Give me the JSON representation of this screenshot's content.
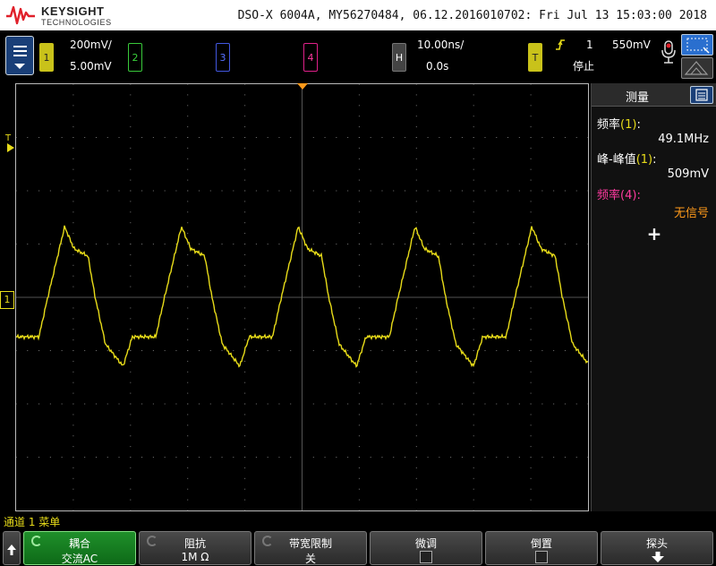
{
  "title_bar": {
    "brand": "KEYSIGHT",
    "brand_sub": "TECHNOLOGIES",
    "device_info": "DSO-X 6004A, MY56270484, 06.12.2016010702: Fri Jul 13 15:03:00 2018"
  },
  "channels": {
    "ch1": {
      "label": "1",
      "scale": "200mV/",
      "offset": "5.00mV",
      "color": "#e8dc19"
    },
    "ch2": {
      "label": "2",
      "color": "#3bd43c"
    },
    "ch3": {
      "label": "3",
      "color": "#5670ff"
    },
    "ch4": {
      "label": "4",
      "color": "#ff3aa0"
    }
  },
  "horizontal": {
    "label": "H",
    "timebase": "10.00ns/",
    "delay": "0.0s"
  },
  "trigger": {
    "label": "T",
    "source": "1",
    "level": "550mV",
    "status": "停止",
    "edge_icon": "rising-edge-icon"
  },
  "markers": {
    "trigger_level": "T",
    "ch1_ground": "1"
  },
  "measurements": {
    "title": "测量",
    "items": [
      {
        "label_prefix": "频率",
        "label_chan": "(1)",
        "label_suffix": ":",
        "value": "49.1MHz",
        "color": "#e8dc19"
      },
      {
        "label_prefix": "峰-峰值",
        "label_chan": "(1)",
        "label_suffix": ":",
        "value": "509mV",
        "color": "#e8dc19"
      },
      {
        "label_prefix": "频率",
        "label_chan": "(4)",
        "label_suffix": ":",
        "value": "无信号",
        "color": "#ff9a1a"
      }
    ],
    "add_label": "+"
  },
  "menu": {
    "title": "通道 1 菜单",
    "softkeys": [
      {
        "title": "耦合",
        "value": "交流AC"
      },
      {
        "title": "阻抗",
        "value": "1M Ω"
      },
      {
        "title": "带宽限制",
        "value": "关"
      },
      {
        "title": "微调",
        "value": ""
      },
      {
        "title": "倒置",
        "value": ""
      },
      {
        "title": "探头",
        "value": ""
      }
    ]
  }
}
